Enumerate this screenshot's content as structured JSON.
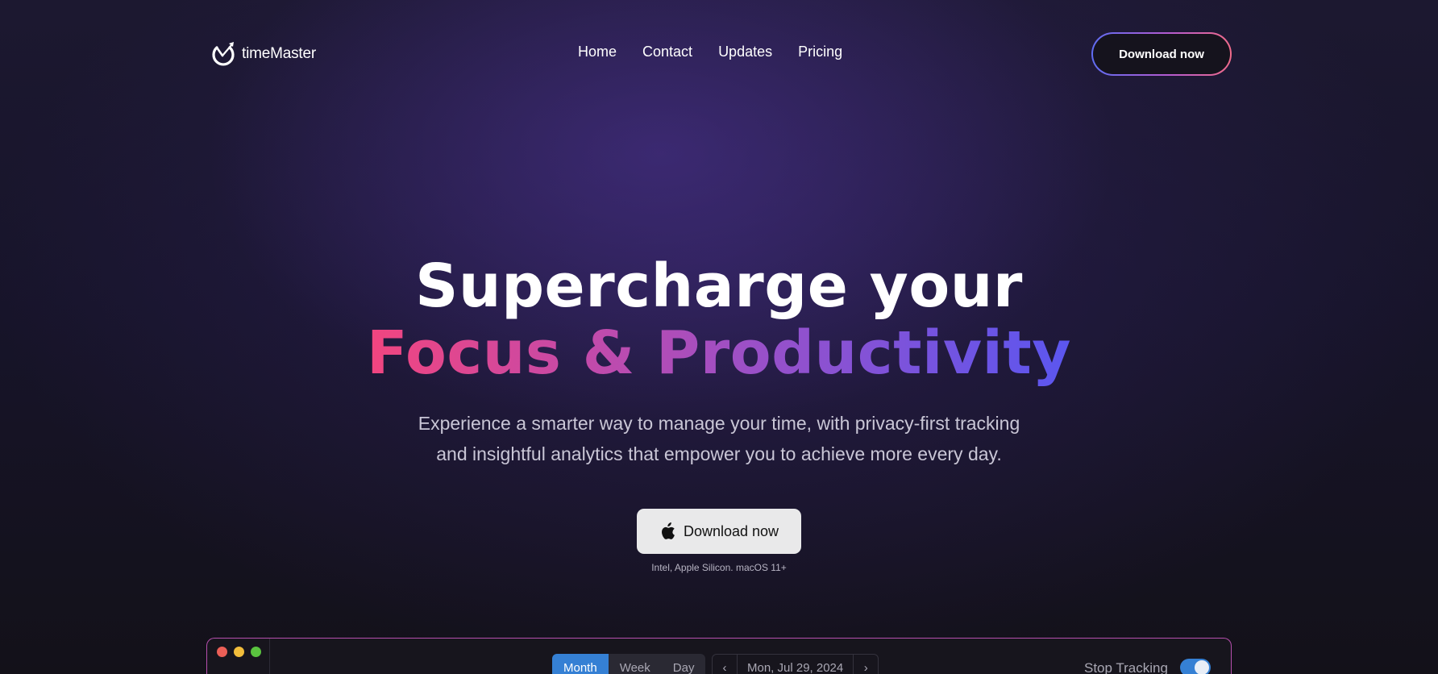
{
  "brand": {
    "name": "timeMaster"
  },
  "nav": {
    "items": [
      "Home",
      "Contact",
      "Updates",
      "Pricing"
    ],
    "cta_label": "Download now"
  },
  "hero": {
    "title_line1": "Supercharge your",
    "title_line2": "Focus & Productivity",
    "subtitle_line1": "Experience a smarter way to manage your time, with privacy-first tracking",
    "subtitle_line2": "and insightful analytics that empower you to achieve more every day.",
    "cta_label": "Download now",
    "cta_icon": "apple-icon",
    "cta_note": "Intel, Apple Silicon. macOS 11+"
  },
  "app_window": {
    "view_tabs": [
      "Month",
      "Week",
      "Day"
    ],
    "active_view": "Month",
    "date": "Mon, Jul 29, 2024",
    "prev_icon": "chevron-left-icon",
    "next_icon": "chevron-right-icon",
    "tracking_label": "Stop Tracking",
    "tracking_on": true
  },
  "colors": {
    "background": "#15131f",
    "gradient_start": "#f2457f",
    "gradient_mid": "#9a50c8",
    "gradient_end": "#5b56f0",
    "accent_blue": "#3580d4",
    "light_red": "#ec5f57",
    "light_yellow": "#f2bd3b",
    "light_green": "#5ac33f"
  }
}
